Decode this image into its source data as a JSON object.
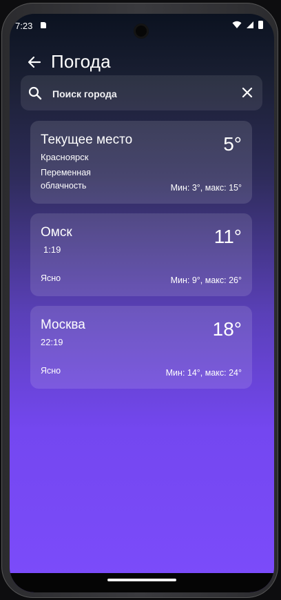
{
  "status_bar": {
    "time": "7:23"
  },
  "header": {
    "title": "Погода"
  },
  "search": {
    "placeholder": "Поиск города"
  },
  "cities": [
    {
      "name": "Текущее место",
      "subtitle": "Красноярск",
      "temperature": "5°",
      "condition": "Переменная облачность",
      "minmax": "Мин: 3°, макс: 15°"
    },
    {
      "name": "Омск",
      "subtitle": "1:19",
      "temperature": "11°",
      "condition": "Ясно",
      "minmax": "Мин: 9°, макс: 26°"
    },
    {
      "name": "Москва",
      "subtitle": "22:19",
      "temperature": "18°",
      "condition": "Ясно",
      "minmax": "Мин: 14°, макс: 24°"
    }
  ],
  "icons": {
    "back": "arrow-left-icon",
    "search": "search-icon",
    "clear": "close-icon",
    "wifi": "wifi-icon",
    "signal": "signal-icon",
    "battery": "battery-icon"
  },
  "colors": {
    "background_top": "#0b1220",
    "background_bottom": "#7c4cfb",
    "text": "#ffffff"
  }
}
